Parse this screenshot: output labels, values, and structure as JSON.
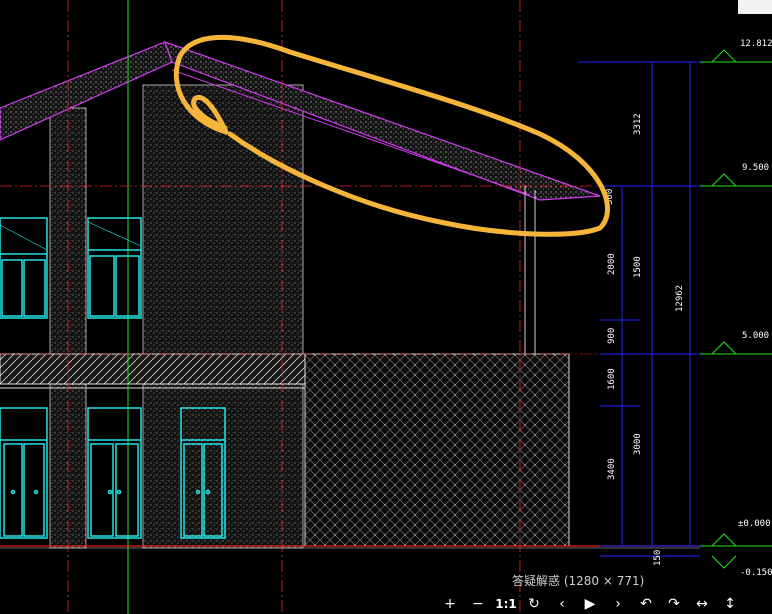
{
  "window": {
    "caption": "答疑解惑 (1280 × 771)"
  },
  "drawing": {
    "elevation_labels": [
      "12.812",
      "9.500",
      "5.000",
      "±0.000",
      "-0.150"
    ],
    "dimension_labels": [
      "3312",
      "2000",
      "1500",
      "900",
      "1600",
      "3000",
      "3400",
      "12962",
      "150",
      "300"
    ]
  },
  "toolbar": {
    "zoom_in": "+",
    "zoom_out": "−",
    "actual_size": "1:1",
    "rotate": "↻",
    "prev": "‹",
    "play": "▶",
    "next": "›",
    "undo": "↶",
    "redo": "↷",
    "fit_width": "↔",
    "fit_height": "↕"
  },
  "colors": {
    "background": "#000000",
    "roof_magenta": "#d23cf0",
    "window_cyan": "#27e3e3",
    "axis_red": "#e22222",
    "axis_green": "#22e022",
    "dimension_blue": "#2222ff",
    "annotation_highlight": "#f5b43a"
  }
}
